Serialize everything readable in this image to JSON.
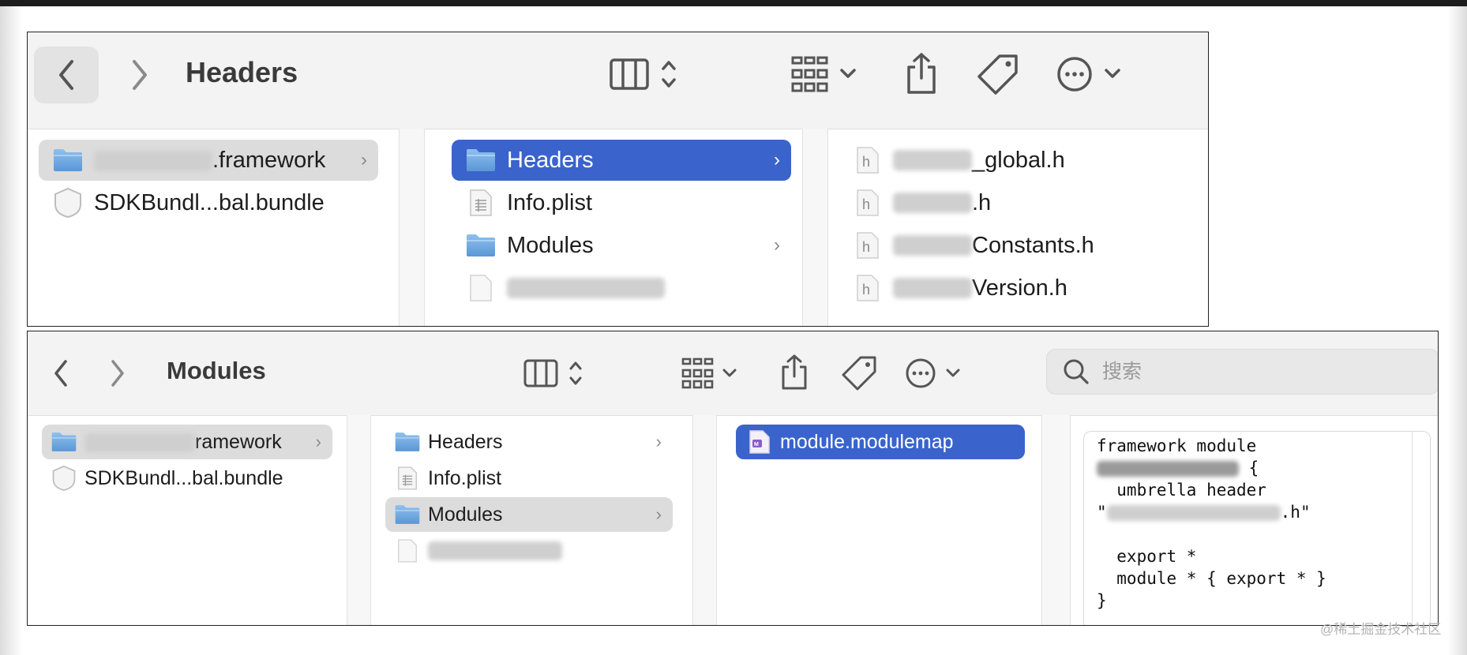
{
  "window1": {
    "title": "Headers",
    "col1": [
      {
        "name_visible": ".framework",
        "selected": true
      },
      {
        "name": "SDKBundl...bal.bundle"
      }
    ],
    "col2": [
      {
        "name": "Headers",
        "selected": true
      },
      {
        "name": "Info.plist"
      },
      {
        "name": "Modules"
      }
    ],
    "col3": [
      {
        "name_visible": "_global.h"
      },
      {
        "name_visible": ".h"
      },
      {
        "name_visible": "Constants.h"
      },
      {
        "name_visible": "Version.h"
      }
    ]
  },
  "window2": {
    "title": "Modules",
    "search_placeholder": "搜索",
    "col1": [
      {
        "name_visible": "ramework",
        "selected": true
      },
      {
        "name": "SDKBundl...bal.bundle"
      }
    ],
    "col2": [
      {
        "name": "Headers"
      },
      {
        "name": "Info.plist"
      },
      {
        "name": "Modules",
        "selected": true
      }
    ],
    "col3": [
      {
        "name": "module.modulemap",
        "selected": true
      }
    ],
    "preview": {
      "line1": "framework module",
      "line2_end": "{",
      "line3": "  umbrella header",
      "line4_start": "\"",
      "line4_end": ".h\"",
      "line6": "  export *",
      "line7": "  module * { export * }",
      "line8": "}"
    }
  },
  "watermark": "@稀土掘金技术社区",
  "colors": {
    "selection_blue": "#3a63cc",
    "selection_grey": "#dcdcdc",
    "folder_blue": "#6fa8dc"
  },
  "icons": [
    "chevron-left-icon",
    "chevron-right-icon",
    "column-view-icon",
    "group-icon",
    "share-icon",
    "tag-icon",
    "more-icon",
    "search-icon",
    "folder-icon",
    "plist-icon",
    "header-file-icon",
    "bundle-icon",
    "modulemap-icon"
  ]
}
